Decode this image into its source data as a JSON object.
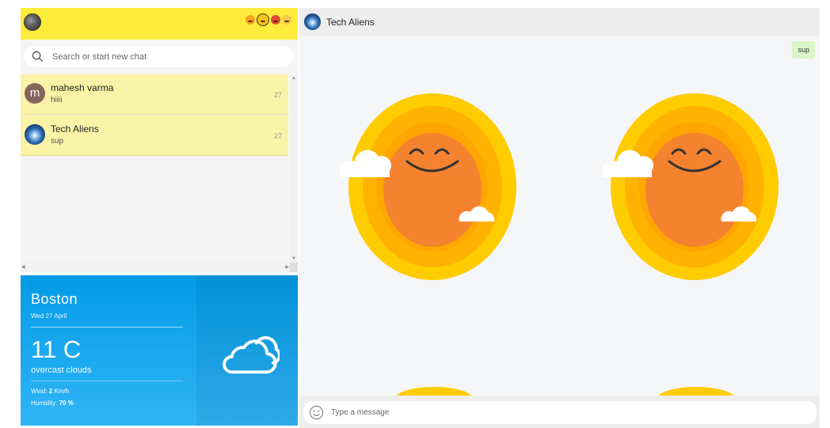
{
  "left_header": {
    "emojis": [
      "tongue-face-icon",
      "neutral-face-icon",
      "angry-face-icon",
      "sweat-face-icon"
    ]
  },
  "search": {
    "placeholder": "Search or start new chat"
  },
  "chats": [
    {
      "initial": "m",
      "name": "mahesh varma",
      "last_message": "hiiii",
      "time": "27"
    },
    {
      "initial": "",
      "name": "Tech Aliens",
      "last_message": "sup",
      "time": "27"
    }
  ],
  "weather": {
    "city": "Boston",
    "date": "Wed 27 April",
    "temperature": "11 C",
    "description": "overcast clouds",
    "wind_label": "Wind:",
    "wind_value": "2",
    "wind_unit": "Km/h",
    "humidity_label": "Humidity:",
    "humidity_value": "70",
    "humidity_unit": "%"
  },
  "conversation": {
    "title": "Tech Aliens",
    "messages": [
      {
        "text": "sup",
        "direction": "outgoing"
      }
    ]
  },
  "composer": {
    "placeholder": "Type a message"
  },
  "colors": {
    "header_yellow": "#ffeb3b",
    "chat_item_bg": "#faf3a7",
    "weather_blue": "#039be5",
    "bubble_green": "#dcf5c8"
  }
}
